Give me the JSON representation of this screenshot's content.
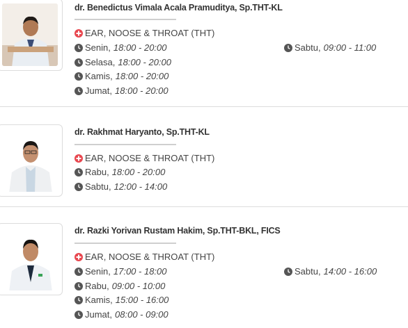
{
  "colors": {
    "specialty_icon": "#e8474f",
    "clock_icon": "#555555",
    "divider": "#dcdcdc"
  },
  "doctors": [
    {
      "name": "dr. Benedictus Vimala Acala Pramuditya, Sp.THT-KL",
      "specialty": "EAR, NOOSE & THROAT (THT)",
      "schedule_left": [
        {
          "day": "Senin,",
          "time": "18:00 - 20:00"
        },
        {
          "day": "Selasa,",
          "time": "18:00 - 20:00"
        },
        {
          "day": "Kamis,",
          "time": "18:00 - 20:00"
        },
        {
          "day": "Jumat,",
          "time": "18:00 - 20:00"
        }
      ],
      "schedule_right": [
        {
          "day": "Sabtu,",
          "time": "09:00 - 11:00"
        }
      ]
    },
    {
      "name": "dr. Rakhmat Haryanto, Sp.THT-KL",
      "specialty": "EAR, NOOSE & THROAT (THT)",
      "schedule_left": [
        {
          "day": "Rabu,",
          "time": "18:00 - 20:00"
        },
        {
          "day": "Sabtu,",
          "time": "12:00 - 14:00"
        }
      ],
      "schedule_right": []
    },
    {
      "name": "dr. Razki Yorivan Rustam Hakim, Sp.THT-BKL, FICS",
      "specialty": "EAR, NOOSE & THROAT (THT)",
      "schedule_left": [
        {
          "day": "Senin,",
          "time": "17:00 - 18:00"
        },
        {
          "day": "Rabu,",
          "time": "09:00 - 10:00"
        },
        {
          "day": "Kamis,",
          "time": "15:00 - 16:00"
        },
        {
          "day": "Jumat,",
          "time": "08:00 - 09:00"
        }
      ],
      "schedule_right": [
        {
          "day": "Sabtu,",
          "time": "14:00 - 16:00"
        }
      ]
    }
  ]
}
